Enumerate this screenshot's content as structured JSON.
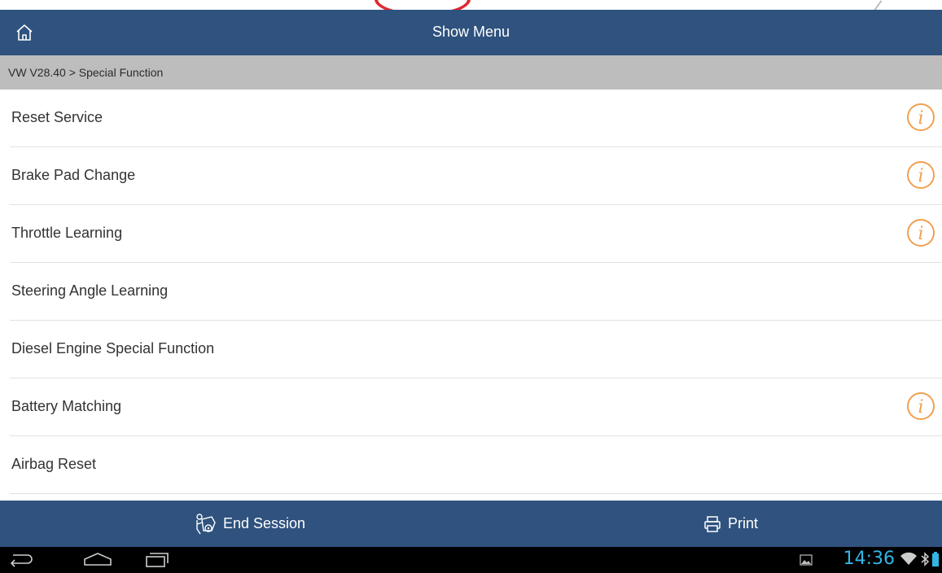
{
  "app": {
    "title": "Show Menu",
    "breadcrumb": "VW V28.40 > Special Function"
  },
  "menu": {
    "items": [
      {
        "label": "Reset Service",
        "has_info": true
      },
      {
        "label": "Brake Pad Change",
        "has_info": true
      },
      {
        "label": "Throttle Learning",
        "has_info": true
      },
      {
        "label": "Steering Angle Learning",
        "has_info": false
      },
      {
        "label": "Diesel Engine Special Function",
        "has_info": false
      },
      {
        "label": "Battery Matching",
        "has_info": true
      },
      {
        "label": "Airbag Reset",
        "has_info": false
      }
    ]
  },
  "actions": {
    "end_session_label": "End Session",
    "print_label": "Print"
  },
  "system_bar": {
    "time": "14:36"
  },
  "colors": {
    "header_bg": "#2f527e",
    "breadcrumb_bg": "#bdbdbd",
    "info_icon": "#f0a050",
    "clock": "#33b5e5"
  },
  "icons": {
    "home": "home-icon",
    "info": "info-icon",
    "end_session": "mechanic-icon",
    "print": "printer-icon",
    "back": "back-icon",
    "home_nav": "home-nav-icon",
    "recents": "recents-icon",
    "gallery": "gallery-notification-icon",
    "wifi": "wifi-icon",
    "bluetooth": "bluetooth-icon",
    "battery": "battery-icon"
  }
}
